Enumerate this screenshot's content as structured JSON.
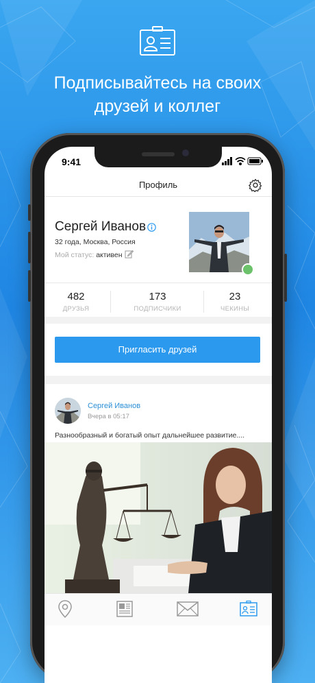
{
  "marketing": {
    "headline": "Подписывайтесь на своих\nдрузей и коллег",
    "icon": "contact-card-icon"
  },
  "status_bar": {
    "time": "9:41"
  },
  "nav": {
    "title": "Профиль",
    "settings_icon": "gear-icon"
  },
  "profile": {
    "name": "Сергей Иванов",
    "meta": "32 года, Москва, Россия",
    "status_label": "Мой статус:",
    "status_value": "активен",
    "online": true
  },
  "stats": [
    {
      "value": "482",
      "label": "ДРУЗЬЯ"
    },
    {
      "value": "173",
      "label": "ПОДПИСЧИКИ"
    },
    {
      "value": "23",
      "label": "ЧЕКИНЫ"
    }
  ],
  "invite_button": "Пригласить друзей",
  "post": {
    "author": "Сергей Иванов",
    "time": "Вчера в 05:17",
    "text": "Разнообразный и богатый опыт дальнейшее развитие...."
  },
  "tabs": [
    {
      "icon": "map-pin-icon",
      "active": false
    },
    {
      "icon": "newspaper-icon",
      "active": false
    },
    {
      "icon": "envelope-icon",
      "active": false
    },
    {
      "icon": "profile-card-icon",
      "active": true
    }
  ],
  "colors": {
    "accent": "#2a99ee",
    "online": "#6cc26a",
    "background": "#2a90e8"
  }
}
